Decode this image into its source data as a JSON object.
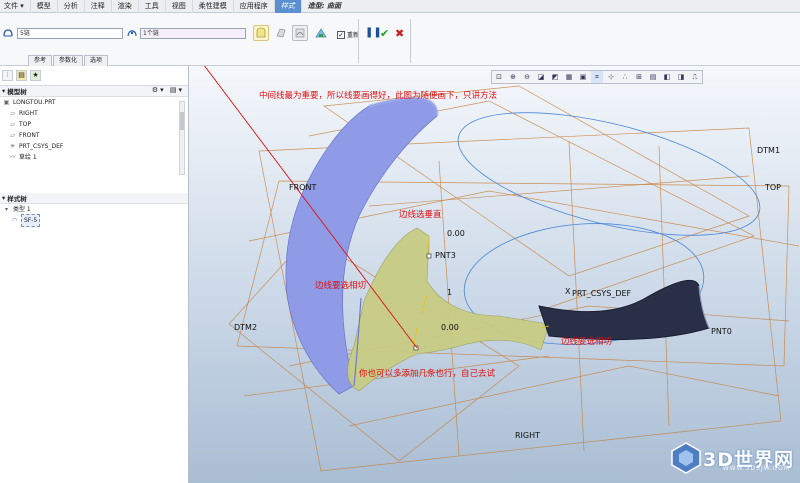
{
  "menu": {
    "items": [
      "文件 ▾",
      "模型",
      "分析",
      "注释",
      "渲染",
      "工具",
      "视图",
      "柔性建模",
      "应用程序",
      "样式"
    ],
    "context": "造型: 曲面"
  },
  "dashboard": {
    "collector1": "5链",
    "collector2": "1个链",
    "checkbox_label": "重新",
    "tabs": [
      "参考",
      "参数化",
      "选项"
    ]
  },
  "navigator": {
    "model_tree_title": "模型树",
    "model_tree_items": [
      "LONGTOU.PRT",
      "RIGHT",
      "TOP",
      "FRONT",
      "PRT_CSYS_DEF",
      "草绘 1"
    ],
    "style_tree_title": "样式树",
    "style_tree_items": [
      "类型 1",
      "SF-5"
    ]
  },
  "viewport": {
    "annotations": {
      "title_note": "中间线最为重要，所以线要画得好，此图为随便画下，只讲方法",
      "edge_vertical": "边线选垂直",
      "edge_tangent_left": "边线要选相切",
      "edge_tangent_right": "边线要选相切",
      "add_more": "你也可以多添加几条也行，自己去试"
    },
    "datum_labels": {
      "dtm1": "DTM1",
      "top": "TOP",
      "front": "FRONT",
      "dtm2": "DTM2",
      "pnt3": "PNT3",
      "pnt0": "PNT0",
      "csys": "PRT_CSYS_DEF",
      "csys_x": "X",
      "right": "RIGHT"
    },
    "dimensions": {
      "top_value": "0.00",
      "mid_value": "1",
      "low_value": "0.00"
    },
    "colors": {
      "annotation_red": "#e01010",
      "surface_blue": "#8f9be6",
      "surface_yellow": "#c8cc84",
      "wireframe_orange": "#c9803a",
      "dark_surface": "#2a2f48"
    }
  },
  "watermark": {
    "main": "3D世界网",
    "sub": "WWW.3DSJW.COM"
  }
}
